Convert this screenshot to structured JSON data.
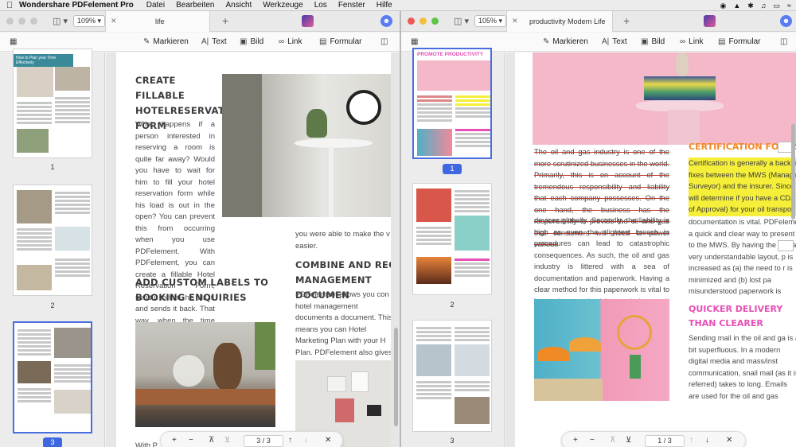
{
  "menubar": {
    "app": "Wondershare PDFelement Pro",
    "items": [
      "Datei",
      "Bearbeiten",
      "Ansicht",
      "Werkzeuge",
      "Los",
      "Fenster",
      "Hilfe"
    ]
  },
  "left": {
    "zoom": "109%",
    "tab_title": "life",
    "toolbar": {
      "markieren": "Markieren",
      "text": "Text",
      "bild": "Bild",
      "link": "Link",
      "formular": "Formular"
    },
    "thumbnails": [
      {
        "num": "1",
        "title": "How to Plan your Time Effectively"
      },
      {
        "num": "2",
        "title": ""
      },
      {
        "num": "3",
        "title": ""
      }
    ],
    "page": {
      "heading1": "CREATE FILLABLE HOTELRESERVATION FORM",
      "para1": "What happens if a person interested in reserving a room is quite far away? Would you have to wait for him to fill your hotel reservation form while his load is out in the open? You can prevent this from occurring when you use PDFelement. With PDFelement, you can create a fillable Hotel Reservation Form, send it to him, he fills it, and sends it back. That way, when the time comes, all your client has to do is move into his room.",
      "heading2": "ADD CUSTOM LABELS TO BOOKING ENQUIRIES",
      "col2_para_top": "you were able to make the v easier.",
      "heading3": "COMBINE AND REORD MANAGEMENT DOCUMEN",
      "col2_para": "PDFelement allows you con hotel management documents a document. This means you can Hotel Marketing Plan with your H Plan. PDFelement also gives you reorder the pages of multiple PD",
      "bottom_text": "With P"
    },
    "nav": {
      "current": "3",
      "sep": "/",
      "total": "3"
    }
  },
  "right": {
    "zoom": "105%",
    "tab_title": "productivity Modern Life",
    "toolbar": {
      "markieren": "Markieren",
      "text": "Text",
      "bild": "Bild",
      "link": "Link",
      "formular": "Formular"
    },
    "thumbnails": [
      {
        "num": "1",
        "title": "PROMOTE PRODUCTIVITY"
      },
      {
        "num": "2",
        "title": ""
      },
      {
        "num": "3",
        "title": ""
      }
    ],
    "page": {
      "col1_strike": "The oil and gas industry is one of the more scrutinized businesses in the world. Primarily, this is on account of the tremendous responsibility and liability that each company possesses. On the one hand, the business has the responsibility to provide the oil and gas that consumers will need to power various",
      "col1_plain": "devices globally. Secondly, the liability is high as even the slightest breech in procedures can lead to catastrophic consequences. As such, the oil and gas industry is littered with a sea of documentation and paperwork. Having a clear method for this paperwork is vital to increasing productivity and by such profitability for the industry.",
      "heading_cert": "CERTIFICATION FORMS",
      "col2_highlight": "Certification is generally a back ar fixes between the MWS (Managin Surveyor) and the insurer. Since will determine if you have a CDA ( of Approval) for your oil transpo and concise methodology for",
      "col2_plain": "documentation is vital. PDFeleme a quick and clear way to present i to the MWS. By having the info a very understandable layout, p is increased as (a) the need to r is minimized and (b) lost pa misunderstood paperwork is great as PDFs as typically delivered digita",
      "heading_delivery": "QUICKER DELIVERY THAN CLEARER DELIVERY THAN EM",
      "col2_para3": "Sending mail in the oil and ga is a bit superfluous. In a modern digital media and mass/inst communication, snail mail (as it is referred) takes to long. Emails are used for the oil and gas industry, is one major flaw. To send ema"
    },
    "nav": {
      "current": "1",
      "sep": "/",
      "total": "3"
    }
  },
  "colors": {
    "accent": "#3e68e0",
    "cert_orange": "#f08a24",
    "delivery_pink": "#e64fb5",
    "highlight_yellow": "#f6ef3a",
    "strike_red": "#c23a2a",
    "pink_bg": "#f4b8c8"
  }
}
